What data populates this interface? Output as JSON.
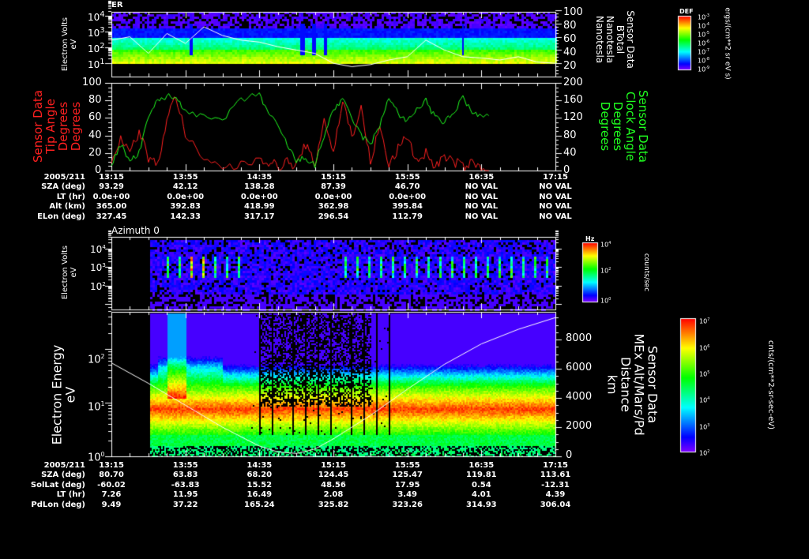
{
  "chart_data": [
    {
      "type": "heatmap",
      "title": "ER",
      "ylabel": "Electron Volts eV",
      "yscale": "log",
      "yticks": [
        "10^1",
        "10^2",
        "10^3",
        "10^4"
      ],
      "y2label": [
        "Sensor Data",
        "BTotal",
        "Nanotesla",
        "Nanotesla"
      ],
      "y2lim": [
        0,
        100
      ],
      "y2ticks": [
        "20",
        "40",
        "60",
        "80",
        "100"
      ],
      "colorbar": {
        "title": "DEF",
        "ticks": [
          "10^-9",
          "10^-8",
          "10^-7",
          "10^-6",
          "10^-5",
          "10^-4",
          "10^-3"
        ],
        "unit": "ergs/(cm**2 sr eV s)"
      },
      "btotal_series": {
        "x_min": [
          0,
          10,
          20,
          30,
          40,
          50,
          60,
          70,
          80,
          90,
          100,
          110,
          120,
          130,
          140,
          150,
          160,
          170,
          180,
          190,
          200,
          210,
          220,
          230,
          240
        ],
        "values": [
          55,
          60,
          35,
          65,
          50,
          75,
          62,
          55,
          52,
          45,
          40,
          35,
          20,
          15,
          18,
          25,
          30,
          55,
          40,
          30,
          28,
          25,
          30,
          22,
          20
        ]
      }
    },
    {
      "type": "line",
      "y1label": [
        "Sensor Data",
        "Tip Angle",
        "Degrees",
        "Degrees"
      ],
      "ylim": [
        0,
        100
      ],
      "yticks": [
        "0",
        "20",
        "40",
        "60",
        "80",
        "100"
      ],
      "y2label": [
        "Sensor Data",
        "Clock Angle",
        "Degrees",
        "Degrees"
      ],
      "y2lim": [
        0,
        200
      ],
      "y2ticks": [
        "0",
        "40",
        "80",
        "120",
        "160",
        "200"
      ],
      "series": [
        {
          "name": "Tip Angle",
          "color": "#ff2020",
          "x_min": [
            0,
            5,
            10,
            15,
            20,
            25,
            30,
            35,
            40,
            50,
            60,
            70,
            80,
            85,
            90,
            95,
            100,
            105,
            110,
            115,
            120,
            125,
            130,
            135,
            140,
            145,
            150,
            155,
            160,
            165,
            170,
            175,
            180,
            185,
            190,
            195,
            200,
            205
          ],
          "values": [
            5,
            40,
            20,
            45,
            15,
            5,
            60,
            85,
            40,
            10,
            5,
            5,
            15,
            10,
            5,
            10,
            5,
            30,
            5,
            60,
            20,
            80,
            40,
            70,
            10,
            50,
            5,
            25,
            40,
            10,
            20,
            5,
            15,
            10,
            5,
            8,
            3,
            2
          ]
        },
        {
          "name": "Clock Angle",
          "color": "#20ff20",
          "x_min": [
            0,
            5,
            10,
            15,
            20,
            25,
            30,
            35,
            40,
            50,
            60,
            70,
            80,
            85,
            90,
            95,
            100,
            105,
            110,
            115,
            120,
            125,
            130,
            135,
            140,
            145,
            150,
            155,
            160,
            165,
            170,
            175,
            180,
            185,
            190,
            195,
            200,
            205
          ],
          "values": [
            10,
            60,
            20,
            40,
            120,
            160,
            170,
            165,
            140,
            120,
            115,
            160,
            175,
            130,
            100,
            60,
            20,
            30,
            10,
            80,
            140,
            160,
            120,
            80,
            60,
            100,
            170,
            130,
            110,
            140,
            160,
            120,
            110,
            130,
            170,
            130,
            125,
            120
          ]
        }
      ]
    },
    {
      "type": "heatmap",
      "title": "Azimuth 0",
      "ylabel": "Electron Volts eV",
      "yscale": "log",
      "yticks": [
        "10^2",
        "10^3",
        "10^4"
      ],
      "colorbar": {
        "title": "Hz",
        "ticks": [
          "10^0",
          "10^2",
          "10^4"
        ],
        "unit": "counts/sec"
      }
    },
    {
      "type": "heatmap",
      "ylabel": "Electron Energy eV",
      "yscale": "log",
      "yticks": [
        "10^0",
        "10^1",
        "10^2"
      ],
      "y2label": [
        "Sensor Data",
        "MEx Alt/Mars/Pd",
        "Distance",
        "km"
      ],
      "y2lim": [
        0,
        9500
      ],
      "y2ticks": [
        "0",
        "2000",
        "4000",
        "6000",
        "8000"
      ],
      "colorbar": {
        "ticks": [
          "10^2",
          "10^3",
          "10^4",
          "10^5",
          "10^6",
          "10^7"
        ],
        "unit": "cnts/(cm**2-sr-sec-eV)"
      },
      "altitude_series": {
        "x_min": [
          0,
          20,
          40,
          60,
          80,
          90,
          100,
          110,
          120,
          140,
          160,
          180,
          200,
          220,
          240
        ],
        "values": [
          6400,
          5000,
          3500,
          2000,
          700,
          300,
          200,
          500,
          1200,
          2800,
          4600,
          6300,
          7700,
          8700,
          9500
        ]
      }
    }
  ],
  "x_ticks": [
    "13:15",
    "13:55",
    "14:35",
    "15:15",
    "15:55",
    "16:35",
    "17:15"
  ],
  "table1": {
    "rows": [
      {
        "label": "2005/211",
        "values": [
          "13:15",
          "13:55",
          "14:35",
          "15:15",
          "15:55",
          "16:35",
          "17:15"
        ]
      },
      {
        "label": "SZA (deg)",
        "values": [
          "93.29",
          "42.12",
          "138.28",
          "87.39",
          "46.70",
          "NO VAL",
          "NO VAL"
        ]
      },
      {
        "label": "LT (hr)",
        "values": [
          "0.0e+00",
          "0.0e+00",
          "0.0e+00",
          "0.0e+00",
          "0.0e+00",
          "NO VAL",
          "NO VAL"
        ]
      },
      {
        "label": "Alt (km)",
        "values": [
          "365.00",
          "392.83",
          "418.99",
          "362.98",
          "395.84",
          "NO VAL",
          "NO VAL"
        ]
      },
      {
        "label": "ELon (deg)",
        "values": [
          "327.45",
          "142.33",
          "317.17",
          "296.54",
          "112.79",
          "NO VAL",
          "NO VAL"
        ]
      }
    ]
  },
  "table2": {
    "rows": [
      {
        "label": "2005/211",
        "values": [
          "13:15",
          "13:55",
          "14:35",
          "15:15",
          "15:55",
          "16:35",
          "17:15"
        ]
      },
      {
        "label": "SZA (deg)",
        "values": [
          "80.70",
          "63.83",
          "68.20",
          "124.45",
          "125.47",
          "119.81",
          "113.61"
        ]
      },
      {
        "label": "SolLat (deg)",
        "values": [
          "-60.02",
          "-63.83",
          "15.52",
          "48.56",
          "17.95",
          "0.54",
          "-12.31"
        ]
      },
      {
        "label": "LT (hr)",
        "values": [
          "7.26",
          "11.95",
          "16.49",
          "2.08",
          "3.49",
          "4.01",
          "4.39"
        ]
      },
      {
        "label": "PdLon (deg)",
        "values": [
          "9.49",
          "37.22",
          "165.24",
          "325.82",
          "323.26",
          "314.93",
          "306.04"
        ]
      }
    ]
  }
}
